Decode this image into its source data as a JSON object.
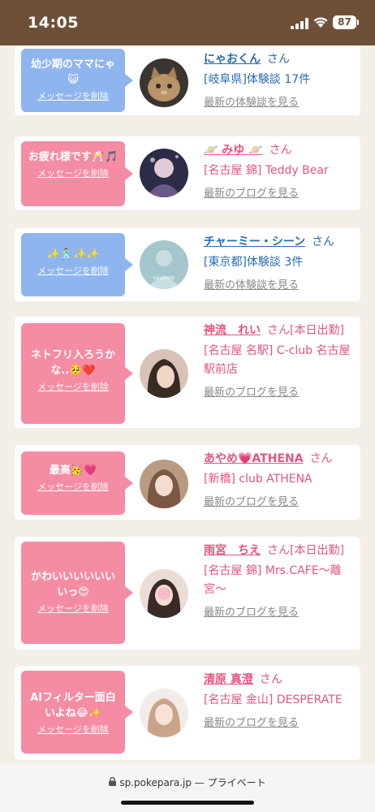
{
  "status_bar": {
    "time": "14:05",
    "battery": "87"
  },
  "entries": [
    {
      "message": "幼少期のママにゃ😺",
      "delete_label": "メッセージを削除",
      "name": "にゃおくん",
      "honorific": "さん",
      "location": "[岐阜県]体験談 17件",
      "link": "最新の体験談を見る",
      "theme": "blue"
    },
    {
      "message": "お疲れ様です🥂🎵",
      "delete_label": "メッセージを削除",
      "name": "🪐 みゆ 🪐",
      "honorific": "さん",
      "location": "[名古屋 錦] Teddy Bear",
      "link": "最新のブログを見る",
      "theme": "pink"
    },
    {
      "message": "✨🕺✨✨",
      "delete_label": "メッセージを削除",
      "name": "チャーミー・シーン",
      "honorific": "さん",
      "location": "[東京都]体験談 3件",
      "link": "最新の体験談を見る",
      "theme": "blue",
      "avatar_text": "no photo"
    },
    {
      "message": "ネトフリ入ろうかな..🥺❤️",
      "delete_label": "メッセージを削除",
      "name": "神流　れい",
      "honorific": "さん[本日出勤]",
      "location": "[名古屋 名駅] C-club 名古屋駅前店",
      "link": "最新のブログを見る",
      "theme": "pink"
    },
    {
      "message": "最高🥳💗",
      "delete_label": "メッセージを削除",
      "name": "あやめ💗ATHENA",
      "honorific": "さん",
      "location": "[新橋] club ATHENA",
      "link": "最新のブログを見る",
      "theme": "pink"
    },
    {
      "message": "かわいいいいいいいっ😍",
      "delete_label": "メッセージを削除",
      "name": "雨宮　ちえ",
      "honorific": "さん[本日出勤]",
      "location": "[名古屋 錦] Mrs.CAFE〜離宮〜",
      "link": "最新のブログを見る",
      "theme": "pink"
    },
    {
      "message": "AIフィルター面白いよね😂✨",
      "delete_label": "メッセージを削除",
      "name": "清原 真澄",
      "honorific": "さん",
      "location": "[名古屋 金山] DESPERATE",
      "link": "最新のブログを見る",
      "theme": "pink"
    }
  ],
  "browser": {
    "domain": "sp.pokepara.jp",
    "mode": "— プライベート"
  },
  "colors": {
    "status_bar": "#6e5038",
    "bubble_blue": "#8fb5ef",
    "bubble_pink": "#f48ca4",
    "text_blue": "#2a6cb1",
    "text_pink": "#e5557e"
  }
}
